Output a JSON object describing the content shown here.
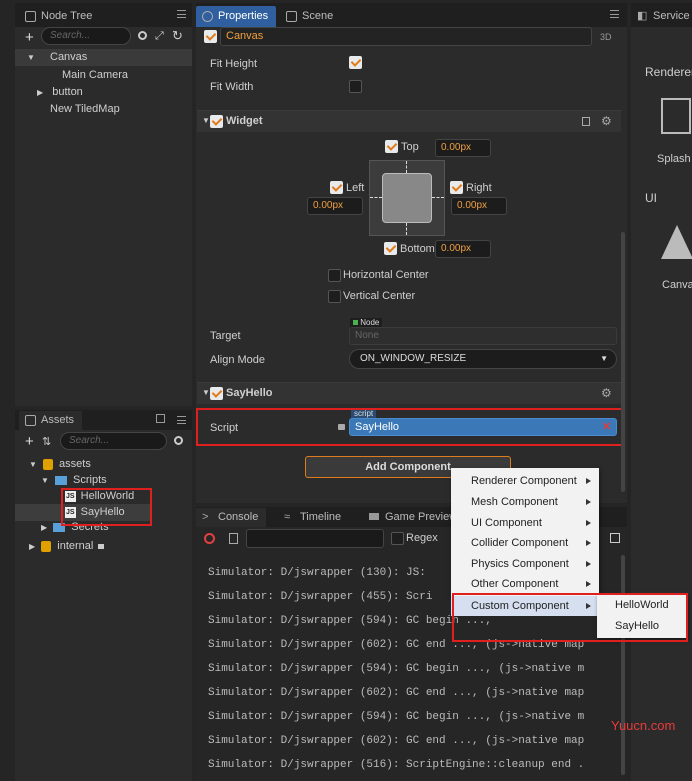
{
  "node_tree": {
    "tab_label": "Node Tree",
    "search_placeholder": "Search...",
    "items": [
      {
        "label": "Canvas"
      },
      {
        "label": "Main Camera"
      },
      {
        "label": "button"
      },
      {
        "label": "New TiledMap"
      }
    ]
  },
  "assets": {
    "tab_label": "Assets",
    "search_placeholder": "Search...",
    "items": [
      {
        "label": "assets"
      },
      {
        "label": "Scripts"
      },
      {
        "label": "HelloWorld",
        "badge": "JS"
      },
      {
        "label": "SayHello",
        "badge": "JS"
      },
      {
        "label": "Secrets"
      },
      {
        "label": "internal"
      }
    ]
  },
  "properties": {
    "tab_label": "Properties",
    "scene_tab_label": "Scene",
    "node_name": "Canvas",
    "mode_3d": "3D",
    "fit_height_label": "Fit Height",
    "fit_height": true,
    "fit_width_label": "Fit Width",
    "fit_width": false,
    "widget": {
      "title": "Widget",
      "top_label": "Top",
      "top_value": "0.00px",
      "left_label": "Left",
      "left_value": "0.00px",
      "right_label": "Right",
      "right_value": "0.00px",
      "bottom_label": "Bottom",
      "bottom_value": "0.00px",
      "horizontal_center": "Horizontal Center",
      "vertical_center": "Vertical Center",
      "target_label": "Target",
      "target_tag": "Node",
      "target_value": "None",
      "align_mode_label": "Align Mode",
      "align_mode_value": "ON_WINDOW_RESIZE"
    },
    "say_hello": {
      "title": "SayHello",
      "script_label": "Script",
      "script_tag": "script",
      "script_value": "SayHello"
    },
    "add_component_label": "Add Component"
  },
  "service": {
    "tab_label": "Service",
    "renderer_label": "Renderer",
    "splash_label": "Splash",
    "ui_label": "UI",
    "canvas_label": "Canvas"
  },
  "console": {
    "tabs": [
      {
        "label": "Console"
      },
      {
        "label": "Timeline"
      },
      {
        "label": "Game Preview"
      }
    ],
    "regex_label": "Regex",
    "lines": [
      "Simulator: D/jswrapper (130): JS:",
      "Simulator: D/jswrapper (455): Scri",
      "Simulator: D/jswrapper (594): GC begin ...,",
      "Simulator: D/jswrapper (602): GC end ..., (js->native map",
      "Simulator: D/jswrapper (594): GC begin ..., (js->native m",
      "Simulator: D/jswrapper (602): GC end ..., (js->native map",
      "Simulator: D/jswrapper (594): GC begin ..., (js->native m",
      "Simulator: D/jswrapper (602): GC end ..., (js->native map",
      "Simulator: D/jswrapper (516): ScriptEngine::cleanup end ."
    ]
  },
  "context_menu": {
    "items": [
      {
        "label": "Renderer Component"
      },
      {
        "label": "Mesh Component"
      },
      {
        "label": "UI Component"
      },
      {
        "label": "Collider Component"
      },
      {
        "label": "Physics Component"
      },
      {
        "label": "Other Component"
      },
      {
        "label": "Custom Component"
      }
    ],
    "submenu": [
      {
        "label": "HelloWorld"
      },
      {
        "label": "SayHello"
      }
    ]
  },
  "watermark": "Yuucn.com",
  "colors": {
    "accent_blue": "#2f5f9e",
    "accent_orange": "#e07b1c",
    "highlight_red": "#e01f1f"
  }
}
